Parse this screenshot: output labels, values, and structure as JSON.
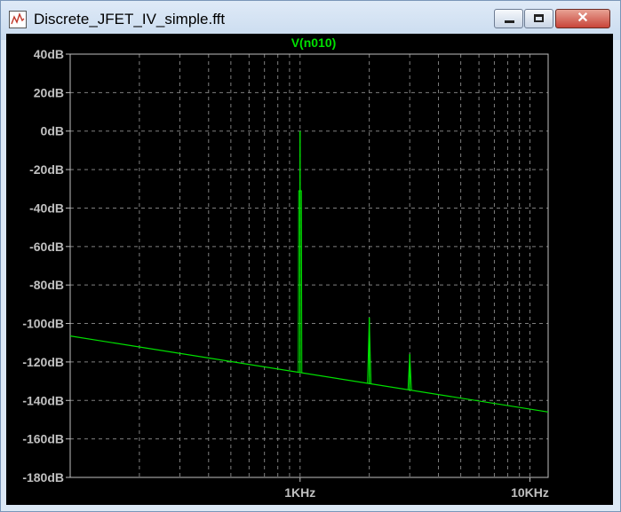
{
  "window": {
    "title": "Discrete_JFET_IV_simple.fft",
    "icon": "waveform-file-icon",
    "controls": {
      "minimize": "minimize-icon",
      "maximize": "maximize-icon",
      "close": "close-icon",
      "close_glyph": "✕"
    }
  },
  "colors": {
    "background": "#000000",
    "trace": "#00e000",
    "grid": "#7f7f7f",
    "axis_text": "#c0c0c0",
    "trace_label": "#00e000"
  },
  "chart_data": {
    "type": "line",
    "title": "V(n010)",
    "xscale": "log",
    "xlim": [
      100,
      12000
    ],
    "ylim": [
      -180,
      40
    ],
    "y_ticks": [
      40,
      20,
      0,
      -20,
      -40,
      -60,
      -80,
      -100,
      -120,
      -140,
      -160,
      -180
    ],
    "y_tick_labels": [
      "40dB",
      "20dB",
      "0dB",
      "-20dB",
      "-40dB",
      "-60dB",
      "-80dB",
      "-100dB",
      "-120dB",
      "-140dB",
      "-160dB",
      "-180dB"
    ],
    "x_tick_labels": [
      {
        "value": 1000,
        "label": "1KHz"
      },
      {
        "value": 10000,
        "label": "10KHz"
      }
    ],
    "grid": true,
    "series": [
      {
        "name": "V(n010)",
        "noise_floor": [
          [
            100,
            -106.5
          ],
          [
            12000,
            -146
          ]
        ],
        "peaks": [
          {
            "x": 1000,
            "y": 0,
            "shoulder": -31
          },
          {
            "x": 2000,
            "y": -97
          },
          {
            "x": 3000,
            "y": -116
          }
        ]
      }
    ]
  }
}
